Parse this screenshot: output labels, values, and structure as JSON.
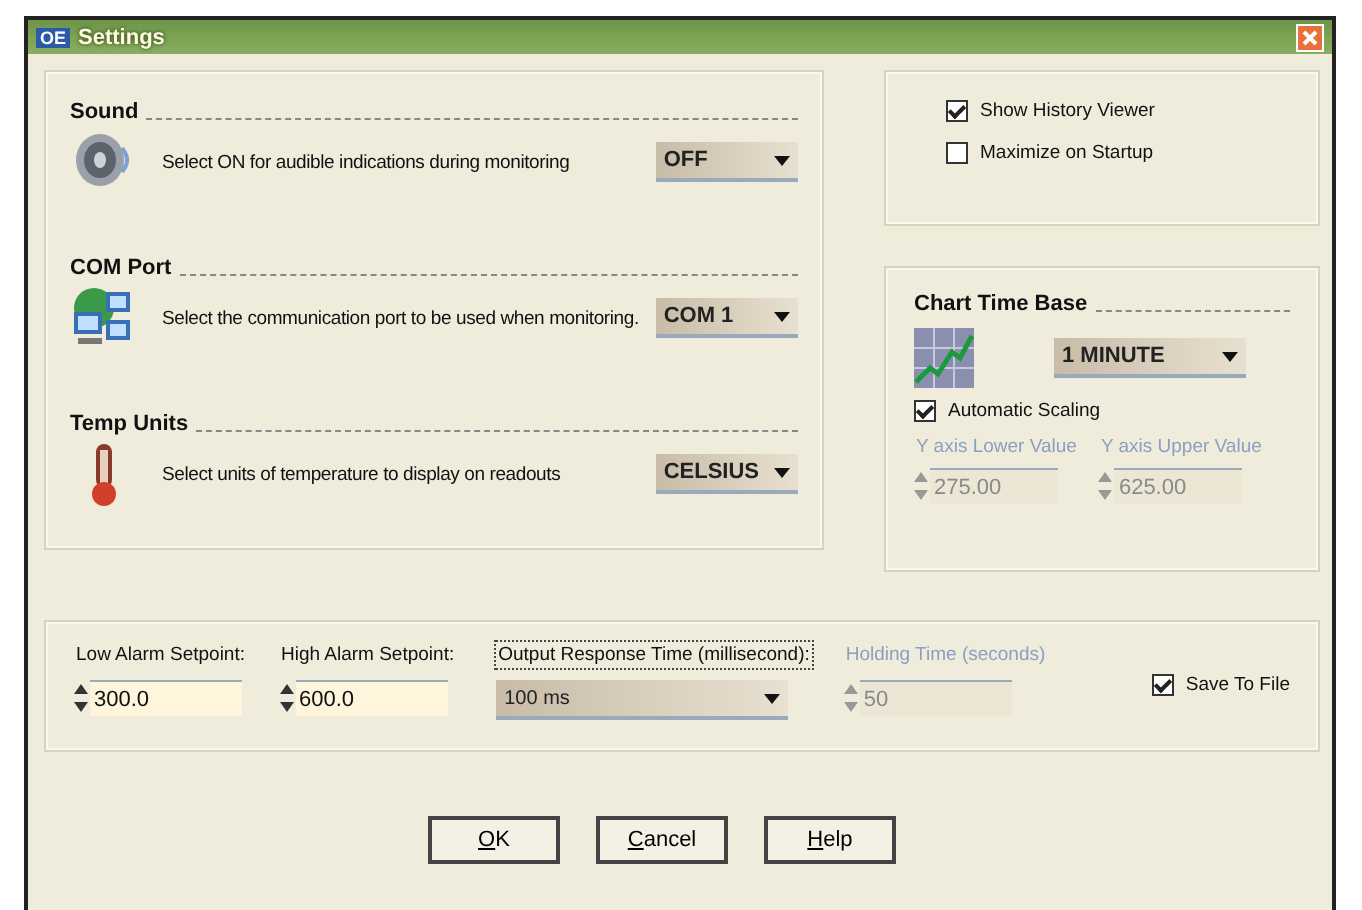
{
  "window": {
    "title": "Settings",
    "logo": "OE"
  },
  "sections": [
    {
      "kind": "sound",
      "title": "Sound",
      "description": "Select ON for audible indications during monitoring",
      "value": "OFF"
    },
    {
      "kind": "port",
      "title": "COM Port",
      "description": "Select the communication port to be used when monitoring.",
      "value": "COM 1"
    },
    {
      "kind": "temp",
      "title": "Temp Units",
      "description": "Select units of temperature to display on readouts",
      "value": "CELSIUS"
    }
  ],
  "options": [
    {
      "label": "Show  History Viewer",
      "checked": true
    },
    {
      "label": "Maximize on Startup",
      "checked": false
    }
  ],
  "chart_time_base": {
    "title": "Chart Time Base",
    "value": "1 MINUTE",
    "auto_scaling": {
      "label": "Automatic Scaling",
      "checked": true
    },
    "fields": [
      {
        "label": "Y axis Lower Value",
        "value": "275.00",
        "disabled": true
      },
      {
        "label": "Y axis Upper Value",
        "value": "625.00",
        "disabled": true
      }
    ]
  },
  "settings": [
    {
      "kind": "spin",
      "label": "Low Alarm Setpoint:",
      "value": "300.0",
      "disabled": false
    },
    {
      "kind": "spin",
      "label": "High Alarm Setpoint:",
      "value": "600.0",
      "disabled": false
    },
    {
      "kind": "select",
      "label": "Output Response Time (millisecond):",
      "value": "100 ms"
    },
    {
      "kind": "spin",
      "label": "Holding Time (seconds)",
      "value": "50",
      "disabled": true
    }
  ],
  "save_to_file": {
    "label": "Save To File",
    "checked": true
  },
  "buttons": [
    "OK",
    "Cancel",
    "Help"
  ]
}
